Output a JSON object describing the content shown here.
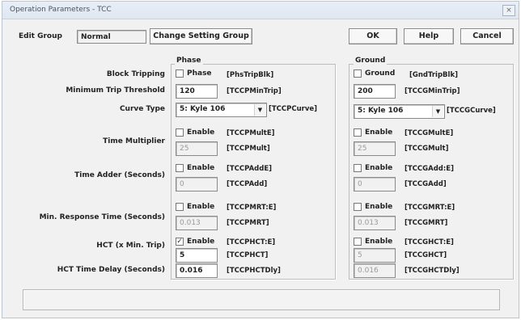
{
  "window": {
    "title": "Operation Parameters - TCC",
    "close_icon": "close-icon"
  },
  "header": {
    "edit_group_label": "Edit Group",
    "edit_group_value": "Normal",
    "change_button": "Change Setting Group",
    "ok_button": "OK",
    "help_button": "Help",
    "cancel_button": "Cancel"
  },
  "labels": {
    "block_tripping": "Block Tripping",
    "min_trip": "Minimum Trip Threshold",
    "curve_type": "Curve Type",
    "time_multiplier": "Time Multiplier",
    "time_adder": "Time Adder (Seconds)",
    "min_response": "Min. Response Time (Seconds)",
    "hct": "HCT (x Min. Trip)",
    "hct_delay": "HCT Time Delay (Seconds)"
  },
  "phase": {
    "title": "Phase",
    "block_check_label": "Phase",
    "block_tag": "[PhsTripBlk]",
    "min_trip_value": "120",
    "min_trip_tag": "[TCCPMinTrip]",
    "curve_value": "5: Kyle 106",
    "curve_tag": "[TCCPCurve]",
    "mult_enable": "Enable",
    "mult_enable_tag": "[TCCPMultE]",
    "mult_value": "25",
    "mult_tag": "[TCCPMult]",
    "adder_enable": "Enable",
    "adder_enable_tag": "[TCCPAddE]",
    "adder_value": "0",
    "adder_tag": "[TCCPAdd]",
    "mrt_enable": "Enable",
    "mrt_enable_tag": "[TCCPMRT:E]",
    "mrt_value": "0.013",
    "mrt_tag": "[TCCPMRT]",
    "hct_enable": "Enable",
    "hct_enable_tag": "[TCCPHCT:E]",
    "hct_value": "5",
    "hct_tag": "[TCCPHCT]",
    "hct_checked_mark": "✓",
    "hct_delay_value": "0.016",
    "hct_delay_tag": "[TCCPHCTDly]"
  },
  "ground": {
    "title": "Ground",
    "block_check_label": "Ground",
    "block_tag": "[GndTripBlk]",
    "min_trip_value": "200",
    "min_trip_tag": "[TCCGMinTrip]",
    "curve_value": "5: Kyle 106",
    "curve_tag": "[TCCGCurve]",
    "mult_enable": "Enable",
    "mult_enable_tag": "[TCCGMultE]",
    "mult_value": "25",
    "mult_tag": "[TCCGMult]",
    "adder_enable": "Enable",
    "adder_enable_tag": "[TCCGAdd:E]",
    "adder_value": "0",
    "adder_tag": "[TCCGAdd]",
    "mrt_enable": "Enable",
    "mrt_enable_tag": "[TCCGMRT:E]",
    "mrt_value": "0.013",
    "mrt_tag": "[TCCGMRT]",
    "hct_enable": "Enable",
    "hct_enable_tag": "[TCCGHCT:E]",
    "hct_value": "5",
    "hct_tag": "[TCCGHCT]",
    "hct_delay_value": "0.016",
    "hct_delay_tag": "[TCCGHCTDly]"
  },
  "status": {
    "text": ""
  }
}
